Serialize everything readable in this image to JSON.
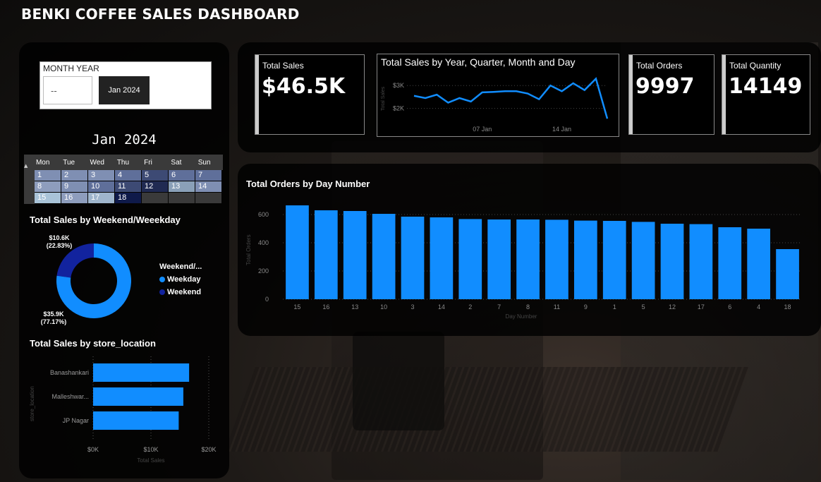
{
  "title": "BENKI COFFEE SALES DASHBOARD",
  "slicer": {
    "title": "MONTH YEAR",
    "empty_option": "--",
    "selected": "Jan 2024"
  },
  "calendar": {
    "title": "Jan 2024",
    "weekdays": [
      "Mon",
      "Tue",
      "Wed",
      "Thu",
      "Fri",
      "Sat",
      "Sun"
    ],
    "rows": [
      [
        {
          "d": "1",
          "c": "#7f8fb3"
        },
        {
          "d": "2",
          "c": "#7f8fb3"
        },
        {
          "d": "3",
          "c": "#7f8fb3"
        },
        {
          "d": "4",
          "c": "#5f6f9a"
        },
        {
          "d": "5",
          "c": "#3d4a74"
        },
        {
          "d": "6",
          "c": "#5f6f9a"
        },
        {
          "d": "7",
          "c": "#5f6f9a"
        }
      ],
      [
        {
          "d": "8",
          "c": "#8e9dbd"
        },
        {
          "d": "9",
          "c": "#7f8fb3"
        },
        {
          "d": "10",
          "c": "#5f6f9a"
        },
        {
          "d": "11",
          "c": "#3d4a74"
        },
        {
          "d": "12",
          "c": "#202a52"
        },
        {
          "d": "13",
          "c": "#8aa0b8"
        },
        {
          "d": "14",
          "c": "#7f8fb3"
        }
      ],
      [
        {
          "d": "15",
          "c": "#a9c3d8"
        },
        {
          "d": "16",
          "c": "#8e9dbd"
        },
        {
          "d": "17",
          "c": "#9fb5cc"
        },
        {
          "d": "18",
          "c": "#0f1a4a"
        },
        {
          "d": "",
          "c": "#3a3a3a"
        },
        {
          "d": "",
          "c": "#3a3a3a"
        },
        {
          "d": "",
          "c": "#3a3a3a"
        }
      ]
    ]
  },
  "weekend_section": {
    "title": "Total Sales by Weekend/Weeekday",
    "legend_title": "Weekend/...",
    "slices": [
      {
        "name": "Weekday",
        "value_label": "$35.9K",
        "pct_label": "(77.17%)",
        "pct": 77.17,
        "color": "#118DFF"
      },
      {
        "name": "Weekend",
        "value_label": "$10.6K",
        "pct_label": "(22.83%)",
        "pct": 22.83,
        "color": "#12239E"
      }
    ]
  },
  "store_section": {
    "title": "Total Sales by store_location",
    "chart_data": {
      "type": "bar",
      "orientation": "horizontal",
      "categories": [
        "Banashankari",
        "Malleshwar...",
        "JP Nagar"
      ],
      "values": [
        16600,
        15600,
        14800
      ],
      "xlim": [
        0,
        20000
      ],
      "xticks": [
        "$0K",
        "$10K",
        "$20K"
      ],
      "xlabel": "Total Sales",
      "ylabel": "store_location",
      "color": "#118DFF"
    }
  },
  "kpis": {
    "total_sales": {
      "label": "Total Sales",
      "value": "$46.5K"
    },
    "total_orders": {
      "label": "Total Orders",
      "value": "9997"
    },
    "total_quantity": {
      "label": "Total Quantity",
      "value": "14149"
    }
  },
  "trend": {
    "title": "Total Sales by Year, Quarter, Month and Day",
    "chart_data": {
      "type": "line",
      "x": [
        "1",
        "2",
        "3",
        "4",
        "5",
        "6",
        "7",
        "8",
        "9",
        "10",
        "11",
        "12",
        "13",
        "14",
        "15",
        "16",
        "17",
        "18"
      ],
      "values": [
        2550,
        2450,
        2600,
        2250,
        2450,
        2300,
        2700,
        2720,
        2750,
        2750,
        2650,
        2400,
        3000,
        2750,
        3100,
        2800,
        3300,
        1550
      ],
      "ylim": [
        1400,
        3500
      ],
      "yticks": [
        "$2K",
        "$3K"
      ],
      "xticks": [
        "07 Jan",
        "14 Jan"
      ],
      "ylabel": "Total Sales",
      "color": "#118DFF"
    }
  },
  "orders": {
    "title": "Total Orders by Day Number",
    "chart_data": {
      "type": "bar",
      "categories": [
        "15",
        "16",
        "13",
        "10",
        "3",
        "14",
        "2",
        "7",
        "8",
        "11",
        "9",
        "1",
        "5",
        "12",
        "17",
        "6",
        "4",
        "18"
      ],
      "values": [
        665,
        630,
        625,
        605,
        585,
        580,
        568,
        565,
        565,
        563,
        557,
        555,
        548,
        535,
        532,
        510,
        500,
        355
      ],
      "ylim": [
        0,
        700
      ],
      "yticks": [
        "0",
        "200",
        "400",
        "600"
      ],
      "xlabel": "Day Number",
      "ylabel": "Total Orders",
      "color": "#118DFF"
    }
  }
}
